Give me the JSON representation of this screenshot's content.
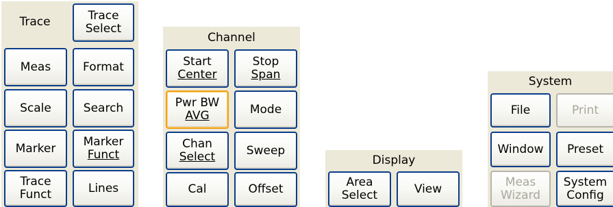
{
  "trace_panel": {
    "label": "Trace",
    "buttons": [
      {
        "lines": [
          "Trace",
          "Select"
        ]
      },
      {
        "lines": [
          "Meas"
        ]
      },
      {
        "lines": [
          "Format"
        ]
      },
      {
        "lines": [
          "Scale"
        ]
      },
      {
        "lines": [
          "Search"
        ]
      },
      {
        "lines": [
          "Marker"
        ]
      },
      {
        "lines": [
          "Marker",
          "Funct"
        ]
      },
      {
        "lines": [
          "Trace",
          "Funct"
        ]
      },
      {
        "lines": [
          "Lines"
        ]
      }
    ]
  },
  "channel_panel": {
    "label": "Channel",
    "buttons": [
      {
        "lines": [
          "Start",
          "Center"
        ]
      },
      {
        "lines": [
          "Stop",
          "Span"
        ]
      },
      {
        "lines": [
          "Pwr BW",
          "AVG"
        ]
      },
      {
        "lines": [
          "Mode"
        ]
      },
      {
        "lines": [
          "Chan",
          "Select"
        ]
      },
      {
        "lines": [
          "Sweep"
        ]
      },
      {
        "lines": [
          "Cal"
        ]
      },
      {
        "lines": [
          "Offset"
        ]
      }
    ]
  },
  "display_panel": {
    "label": "Display",
    "buttons": [
      {
        "lines": [
          "Area",
          "Select"
        ]
      },
      {
        "lines": [
          "View"
        ]
      }
    ]
  },
  "system_panel": {
    "label": "System",
    "buttons": [
      {
        "lines": [
          "File"
        ]
      },
      {
        "lines": [
          "Print"
        ]
      },
      {
        "lines": [
          "Window"
        ]
      },
      {
        "lines": [
          "Preset"
        ]
      },
      {
        "lines": [
          "Meas",
          "Wizard"
        ]
      },
      {
        "lines": [
          "System",
          "Config"
        ]
      }
    ]
  },
  "colors": {
    "panel_bg": "#ece9d8",
    "button_border": "#0a3d8a",
    "highlight_border": "#f2a01a",
    "disabled_text": "#aaa79a"
  }
}
